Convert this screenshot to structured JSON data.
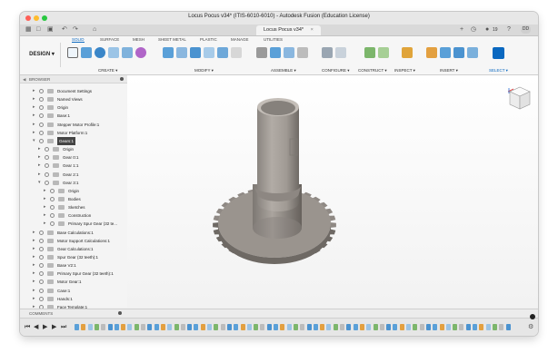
{
  "window": {
    "title": "Locus Pocus v34* (ITIS-6010-6010) - Autodesk Fusion (Education License)",
    "traffic_lights": [
      "#ff5f57",
      "#febc2e",
      "#28c840"
    ]
  },
  "tabbar": {
    "document_tab": "Locus Pocus v34*",
    "badge": "19",
    "user_initials": "DD"
  },
  "workspace": {
    "design_label": "DESIGN ▾",
    "tabs": [
      "SOLID",
      "SURFACE",
      "MESH",
      "SHEET METAL",
      "PLASTIC",
      "MANAGE",
      "UTILITIES"
    ],
    "active_tab": "SOLID",
    "groups": [
      "CREATE ▾",
      "MODIFY ▾",
      "ASSEMBLE ▾",
      "CONFIGURE ▾",
      "CONSTRUCT ▾",
      "INSPECT ▾",
      "INSERT ▾",
      "SELECT ▾"
    ],
    "accent_color": "#0a68c0"
  },
  "browser": {
    "header": "BROWSER",
    "items": [
      {
        "label": "Document Settings"
      },
      {
        "label": "Named Views"
      },
      {
        "label": "Origin"
      },
      {
        "label": "Base:1"
      },
      {
        "label": "Stepper Motor Profile:1"
      },
      {
        "label": "Motor Platform:1"
      },
      {
        "label": "Gears:1"
      },
      {
        "label": "Origin"
      },
      {
        "label": "Gear 0:1"
      },
      {
        "label": "Gear 1:1"
      },
      {
        "label": "Gear 2:1"
      },
      {
        "label": "Gear 3:1"
      },
      {
        "label": "Origin"
      },
      {
        "label": "Bodies"
      },
      {
        "label": "Sketches"
      },
      {
        "label": "Construction"
      },
      {
        "label": "Primary Spur Gear (32 te..."
      },
      {
        "label": "Base Calculations:1"
      },
      {
        "label": "Motor Support Calculations:1"
      },
      {
        "label": "Gear Calculations:1"
      },
      {
        "label": "Spur Gear (32 teeth):1"
      },
      {
        "label": "Base V2:1"
      },
      {
        "label": "Primary Spur Gear (32 teeth):1"
      },
      {
        "label": "Motor Gear:1"
      },
      {
        "label": "Case:1"
      },
      {
        "label": "Hands:1"
      },
      {
        "label": "Face Template:1"
      }
    ]
  },
  "comments": {
    "label": "COMMENTS"
  },
  "icons": [
    "home-icon",
    "undo-icon",
    "redo-icon",
    "save-icon",
    "grid-icon",
    "view-cube-icon",
    "orbit-icon",
    "pan-icon",
    "zoom-icon",
    "display-settings-icon",
    "play-icon",
    "settings-icon"
  ]
}
